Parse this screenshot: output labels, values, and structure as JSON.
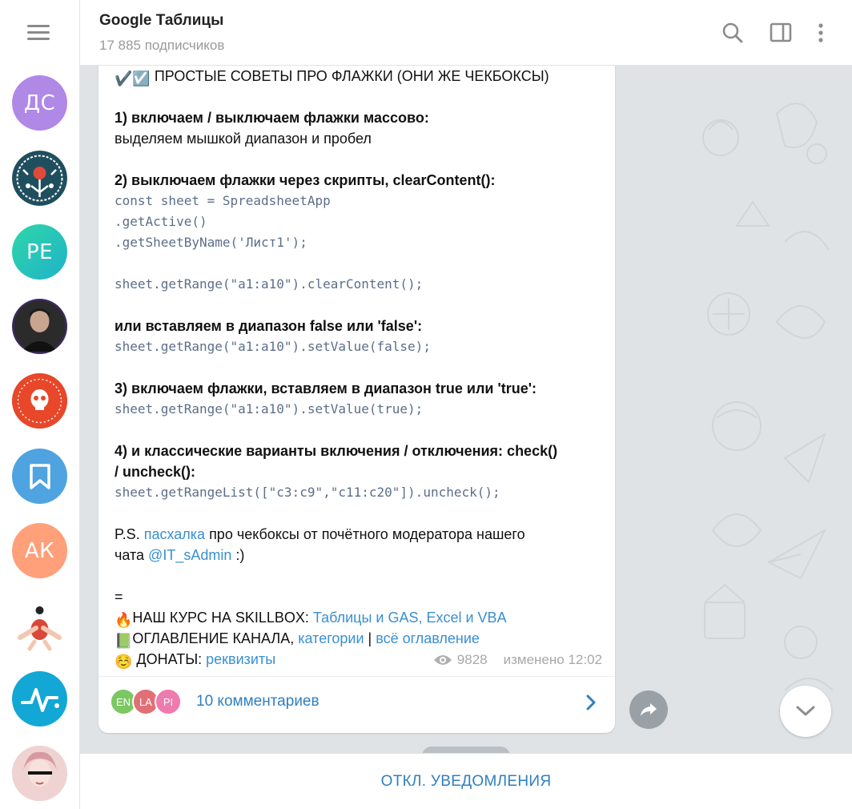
{
  "header": {
    "title": "Google Таблицы",
    "subtitle": "17 885 подписчиков",
    "icons": [
      "search-icon",
      "sidebar-panel-icon",
      "more-vertical-icon"
    ]
  },
  "sidebar": {
    "menu_icon": "hamburger-menu-icon",
    "chats": [
      {
        "initials": "ДС",
        "color": "#b088e6"
      },
      {
        "initials": "",
        "color": "#1f4f5e",
        "icon": "ornament-avatar"
      },
      {
        "initials": "PE",
        "color": "#2fcfb0"
      },
      {
        "initials": "",
        "color": "#2b2b2b",
        "icon": "photo-avatar"
      },
      {
        "initials": "",
        "color": "#e8472a",
        "icon": "skull-logo-avatar"
      },
      {
        "initials": "",
        "color": "#4fa3e0",
        "icon": "bookmark-icon"
      },
      {
        "initials": "АК",
        "color": "#ffa07a"
      },
      {
        "initials": "",
        "color": "#ffffff",
        "icon": "illustration-avatar"
      },
      {
        "initials": "",
        "color": "#12a7d4",
        "icon": "pulse-icon"
      },
      {
        "initials": "",
        "color": "#e8bfc0",
        "icon": "photo-avatar"
      }
    ]
  },
  "message": {
    "title_emojis": "✔️☑️",
    "title_text": " ПРОСТЫЕ СОВЕТЫ ПРО ФЛАЖКИ (ОНИ ЖЕ ЧЕКБОКСЫ)",
    "s1_heading": "1) включаем / выключаем флажки массово:",
    "s1_text": "выделяем мышкой диапазон и пробел",
    "s2_heading": "2) выключаем флажки через скрипты, clearContent():",
    "s2_code1": "const sheet = SpreadsheetApp",
    "s2_code2": ".getActive()",
    "s2_code3": ".getSheetByName('Лист1');",
    "s2_code4": "sheet.getRange(\"a1:a10\").clearContent();",
    "s2b_heading": "или вставляем в диапазон false или 'false':",
    "s2b_code": "sheet.getRange(\"a1:a10\").setValue(false);",
    "s3_heading": "3) включаем флажки, вставляем в диапазон true или 'true':",
    "s3_code": "sheet.getRange(\"a1:a10\").setValue(true);",
    "s4_heading1": "4) и классические варианты включения / отключения: check()",
    "s4_heading2": "/ uncheck():",
    "s4_code": "sheet.getRangeList([\"c3:c9\",\"c11:c20\"]).uncheck();",
    "ps_prefix": "P.S. ",
    "ps_link": "пасхалка",
    "ps_mid": " про чекбоксы от почётного модератора нашего",
    "ps_line2_prefix": "чата ",
    "ps_user": "@IT_sAdmin",
    "ps_suffix": " :)",
    "separator": "=",
    "course_emoji": "🔥",
    "course_label": "НАШ КУРС НА SKILLBOX: ",
    "course_link": "Таблицы и GAS, Excel и VBA",
    "toc_emoji": "📗",
    "toc_label": "ОГЛАВЛЕНИЕ КАНАЛА, ",
    "toc_link1": "категории",
    "toc_sep": " | ",
    "toc_link2": "всё оглавление",
    "donate_emoji": "☺️",
    "donate_label": " ДОНАТЫ: ",
    "donate_link": "реквизиты",
    "views": "9828",
    "edited": "изменено 12:02"
  },
  "comments": {
    "avatars": [
      {
        "label": "EN",
        "color": "#7bc862"
      },
      {
        "label": "LA",
        "color": "#e17076"
      },
      {
        "label": "PI",
        "color": "#ee7aae"
      }
    ],
    "label": "10 комментариев"
  },
  "footer": {
    "mute_label": "ОТКЛ. УВЕДОМЛЕНИЯ"
  },
  "colors": {
    "accent": "#2f7fc1",
    "link": "#3a8fd0",
    "chat_background": "#dfe3e6"
  }
}
